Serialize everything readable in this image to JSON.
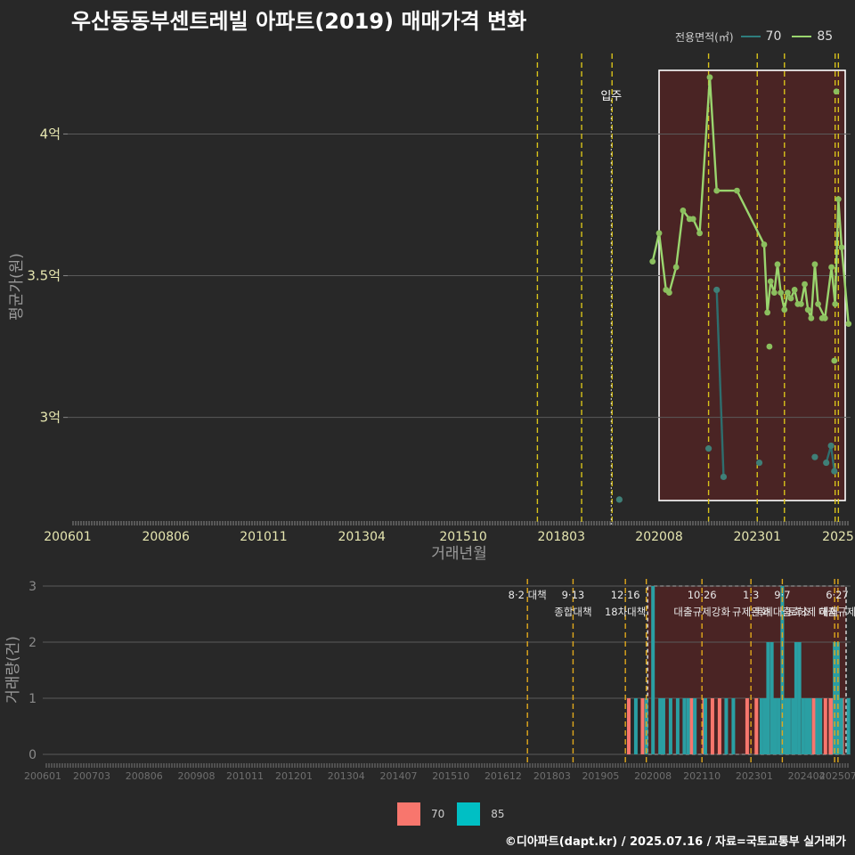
{
  "title": "우산동동부센트레빌 아파트(2019) 매매가격 변화",
  "legend": {
    "label": "전용면적(㎡)",
    "items": [
      {
        "name": "70",
        "line_color": "#2e7d7d",
        "fill_color": "#f8766d"
      },
      {
        "name": "85",
        "line_color": "#9ad56e",
        "fill_color": "#00bfc4"
      }
    ]
  },
  "footer": "©디아파트(dapt.kr) / 2025.07.16 / 자료=국토교통부 실거래가",
  "chart_data": [
    {
      "type": "line",
      "xlabel": "거래년월",
      "ylabel": "평균가(원)",
      "xlim": [
        2006.0,
        2025.3
      ],
      "ylim": [
        2.65,
        4.3
      ],
      "x_ticks": [
        {
          "x": 2006.0,
          "label": "200601"
        },
        {
          "x": 2008.42,
          "label": "200806"
        },
        {
          "x": 2010.83,
          "label": "201011"
        },
        {
          "x": 2013.25,
          "label": "201304"
        },
        {
          "x": 2015.75,
          "label": "201510"
        },
        {
          "x": 2018.17,
          "label": "201803"
        },
        {
          "x": 2020.58,
          "label": "202008"
        },
        {
          "x": 2023.0,
          "label": "202301"
        },
        {
          "x": 2025.0,
          "label": "2025"
        }
      ],
      "y_ticks": [
        {
          "y": 3.0,
          "label": "3억"
        },
        {
          "y": 3.5,
          "label": "3.5억"
        },
        {
          "y": 4.0,
          "label": "4억"
        }
      ],
      "annotation": {
        "label": "입주",
        "x": 2019.4
      },
      "highlight_range": [
        2020.58,
        2025.3
      ],
      "policy_lines": [
        2017.58,
        2018.67,
        2019.42,
        2021.8,
        2023.0,
        2023.67,
        2024.92,
        2025.0
      ],
      "series": [
        {
          "name": "70",
          "segments": [
            {
              "x": [
                2022.0,
                2022.17
              ],
              "y": [
                3.45,
                2.79
              ]
            },
            {
              "x": [
                2024.7,
                2024.82,
                2024.9
              ],
              "y": [
                2.84,
                2.9,
                2.81
              ]
            }
          ],
          "points": {
            "x": [
              2019.6,
              2021.8,
              2022.0,
              2022.17,
              2023.05,
              2024.42,
              2024.7,
              2024.82,
              2024.9
            ],
            "y": [
              2.71,
              2.89,
              3.45,
              2.79,
              2.84,
              2.86,
              2.84,
              2.9,
              2.81
            ]
          }
        },
        {
          "name": "85",
          "x": [
            2020.42,
            2020.58,
            2020.75,
            2020.83,
            2021.0,
            2021.17,
            2021.33,
            2021.42,
            2021.58,
            2021.83,
            2022.0,
            2022.5,
            2023.17,
            2023.25,
            2023.33,
            2023.42,
            2023.5,
            2023.58,
            2023.67,
            2023.75,
            2023.83,
            2023.92,
            2024.0,
            2024.08,
            2024.17,
            2024.25,
            2024.33,
            2024.42,
            2024.5,
            2024.67,
            2024.83,
            2024.92,
            2025.0,
            2025.08,
            2025.25
          ],
          "y": [
            3.55,
            3.65,
            3.45,
            3.44,
            3.53,
            3.73,
            3.7,
            3.7,
            3.65,
            4.2,
            3.8,
            3.8,
            3.61,
            3.37,
            3.48,
            3.44,
            3.54,
            3.44,
            3.38,
            3.44,
            3.42,
            3.45,
            3.4,
            3.4,
            3.47,
            3.38,
            3.35,
            3.54,
            3.4,
            3.35,
            3.53,
            3.4,
            3.77,
            3.6,
            3.33
          ],
          "extra_points": {
            "x": [
              2023.3,
              2024.6,
              2024.9,
              2024.95
            ],
            "y": [
              3.25,
              3.35,
              3.2,
              4.15
            ]
          }
        }
      ]
    },
    {
      "type": "bar",
      "ylabel": "거래량(건)",
      "xlim": [
        2006.0,
        2025.3
      ],
      "ylim": [
        0,
        3
      ],
      "x_ticks": [
        {
          "x": 2006.0,
          "label": "200601"
        },
        {
          "x": 2007.17,
          "label": "200703"
        },
        {
          "x": 2008.42,
          "label": "200806"
        },
        {
          "x": 2009.67,
          "label": "200908"
        },
        {
          "x": 2010.83,
          "label": "201011"
        },
        {
          "x": 2012.0,
          "label": "201201"
        },
        {
          "x": 2013.25,
          "label": "201304"
        },
        {
          "x": 2014.5,
          "label": "201407"
        },
        {
          "x": 2015.75,
          "label": "201510"
        },
        {
          "x": 2017.0,
          "label": "201612"
        },
        {
          "x": 2018.17,
          "label": "201803"
        },
        {
          "x": 2019.33,
          "label": "201905"
        },
        {
          "x": 2020.58,
          "label": "202008"
        },
        {
          "x": 2021.75,
          "label": "202110"
        },
        {
          "x": 2023.0,
          "label": "202301"
        },
        {
          "x": 2024.25,
          "label": "202404"
        },
        {
          "x": 2025.0,
          "label": "202507"
        }
      ],
      "y_ticks": [
        0,
        1,
        2,
        3
      ],
      "highlight_range": [
        2020.58,
        2025.3
      ],
      "policy_lines": [
        2017.58,
        2018.67,
        2019.92,
        2020.42,
        2021.75,
        2022.92,
        2023.67,
        2024.92,
        2025.0
      ],
      "policy_labels": [
        {
          "x": 2017.58,
          "lines": [
            "8·2 대책"
          ]
        },
        {
          "x": 2018.67,
          "lines": [
            "9·13",
            "종합대책"
          ]
        },
        {
          "x": 2019.92,
          "lines": [
            "12·16",
            "18차대책"
          ]
        },
        {
          "x": 2021.75,
          "lines": [
            "10·26",
            "대출규제강화"
          ]
        },
        {
          "x": 2022.92,
          "lines": [
            "1·3",
            "규제완화"
          ]
        },
        {
          "x": 2023.67,
          "lines": [
            "9·7",
            "특례대출축소"
          ]
        },
        {
          "x": 2024.4,
          "lines": [
            "",
            "토허제 해제"
          ]
        },
        {
          "x": 2025.0,
          "lines": [
            "6·27",
            "대출규제"
          ]
        }
      ],
      "series": [
        {
          "name": "70",
          "x": [
            2020.0,
            2020.33,
            2021.5,
            2021.8,
            2022.0,
            2022.17,
            2022.83,
            2023.05,
            2024.42,
            2024.7,
            2024.82,
            2024.9,
            2025.1
          ],
          "values": [
            1,
            1,
            1,
            1,
            1,
            1,
            1,
            1,
            1,
            1,
            1,
            1,
            1
          ]
        },
        {
          "name": "85",
          "x": [
            2020.17,
            2020.42,
            2020.58,
            2020.75,
            2020.83,
            2021.0,
            2021.17,
            2021.33,
            2021.42,
            2021.58,
            2021.83,
            2022.33,
            2022.5,
            2023.17,
            2023.25,
            2023.33,
            2023.42,
            2023.5,
            2023.58,
            2023.67,
            2023.75,
            2023.83,
            2023.92,
            2024.0,
            2024.08,
            2024.17,
            2024.25,
            2024.33,
            2024.5,
            2024.58,
            2024.92,
            2025.0,
            2025.08,
            2025.25
          ],
          "values": [
            1,
            1,
            3,
            1,
            1,
            1,
            1,
            1,
            1,
            1,
            1,
            1,
            1,
            1,
            1,
            2,
            2,
            1,
            1,
            3,
            1,
            1,
            1,
            2,
            2,
            1,
            1,
            1,
            1,
            1,
            2,
            2,
            1,
            1
          ]
        }
      ]
    }
  ]
}
